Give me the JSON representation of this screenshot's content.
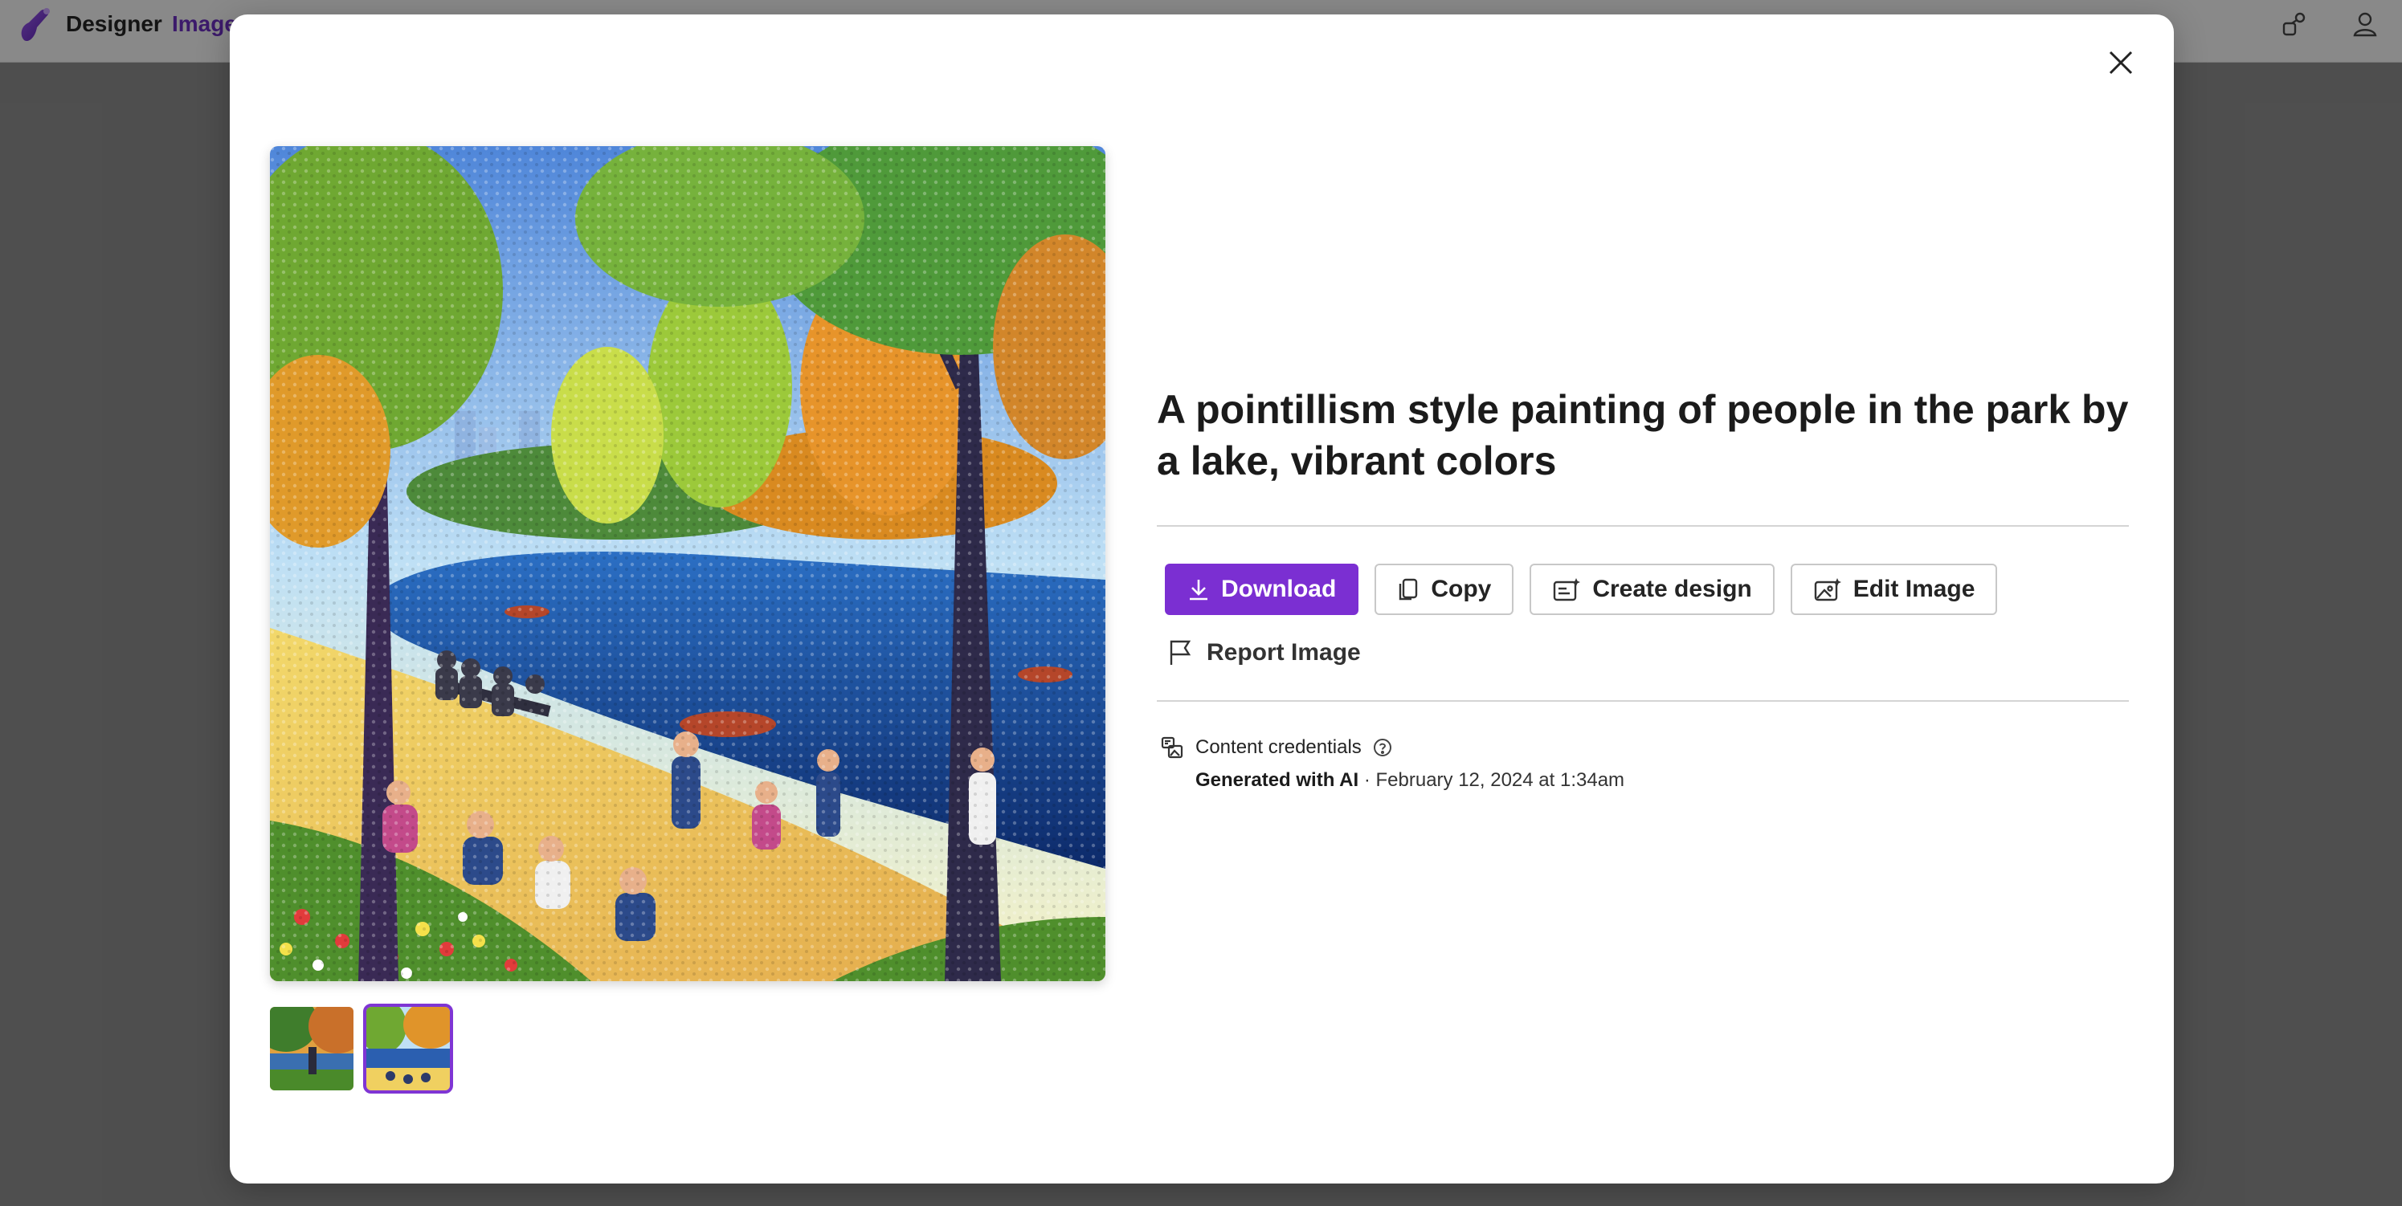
{
  "app": {
    "name": "Designer",
    "section": "Image"
  },
  "modal": {
    "prompt": "A pointillism style painting of people in the park by a lake, vibrant colors",
    "actions": {
      "download": "Download",
      "copy": "Copy",
      "create_design": "Create design",
      "edit_image": "Edit Image",
      "report": "Report Image"
    },
    "credentials": {
      "label": "Content credentials",
      "generated": "Generated with AI",
      "separator": "·",
      "date": "February 12, 2024 at 1:34am"
    },
    "thumbnails": [
      {
        "name": "thumbnail-1",
        "selected": false
      },
      {
        "name": "thumbnail-2",
        "selected": true
      }
    ]
  },
  "colors": {
    "accent": "#7b2fd2",
    "brand_section": "#6b2fbf"
  },
  "icons": [
    "designer-logo-icon",
    "share-icon",
    "account-icon",
    "close-icon",
    "download-icon",
    "copy-icon",
    "create-design-icon",
    "edit-image-icon",
    "flag-icon",
    "content-credentials-icon",
    "help-icon"
  ]
}
